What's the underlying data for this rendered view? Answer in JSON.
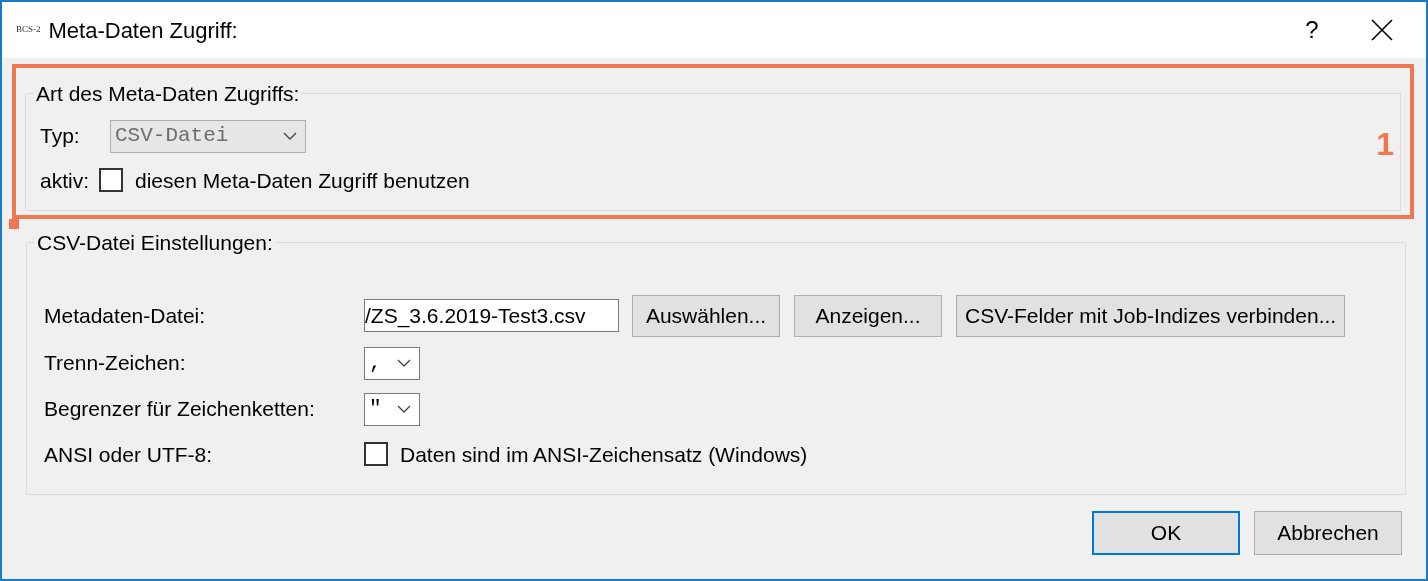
{
  "window": {
    "logo": "BCS-2",
    "title": "Meta-Daten Zugriff:",
    "help": "?"
  },
  "callout": {
    "label": "1"
  },
  "access_group": {
    "title": "Art des Meta-Daten Zugriffs:",
    "type_label": "Typ:",
    "type_value": "CSV-Datei",
    "type_disabled": true,
    "active_label": "aktiv:",
    "active_checkbox": {
      "label": "diesen Meta-Daten Zugriff benutzen",
      "checked": false
    }
  },
  "csv_group": {
    "title": "CSV-Datei Einstellungen:",
    "file_label": "Metadaten-Datei:",
    "file_value": "/ZS_3.6.2019-Test3.csv",
    "file_buttons": [
      "Auswählen...",
      "Anzeigen...",
      "CSV-Felder mit Job-Indizes verbinden..."
    ],
    "separator_label": "Trenn-Zeichen:",
    "separator_value": ",",
    "delimiter_label": "Begrenzer für Zeichenketten:",
    "delimiter_value": "\"",
    "encoding_label": "ANSI oder UTF-8:",
    "encoding_checkbox": {
      "label": "Daten sind im ANSI-Zeichensatz (Windows)",
      "checked": false
    }
  },
  "buttons": [
    {
      "label": "OK",
      "default": true
    },
    {
      "label": "Abbrechen",
      "default": false
    }
  ]
}
